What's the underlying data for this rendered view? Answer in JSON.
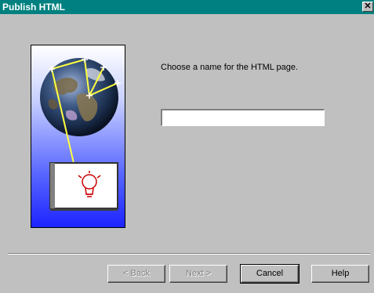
{
  "window": {
    "title": "Publish HTML",
    "close_glyph": "✕"
  },
  "wizard": {
    "prompt": "Choose a name for the HTML page.",
    "name_value": ""
  },
  "buttons": {
    "back": "< Back",
    "next": "Next >",
    "cancel": "Cancel",
    "help": "Help"
  },
  "colors": {
    "title_bar": "#008080",
    "dialog_bg": "#c0c0c0",
    "panel_gradient_bottom": "#1c24ff"
  },
  "icons": {
    "close": "close-icon",
    "illustration": "globe-illustration",
    "lightbulb": "lightbulb-icon"
  }
}
